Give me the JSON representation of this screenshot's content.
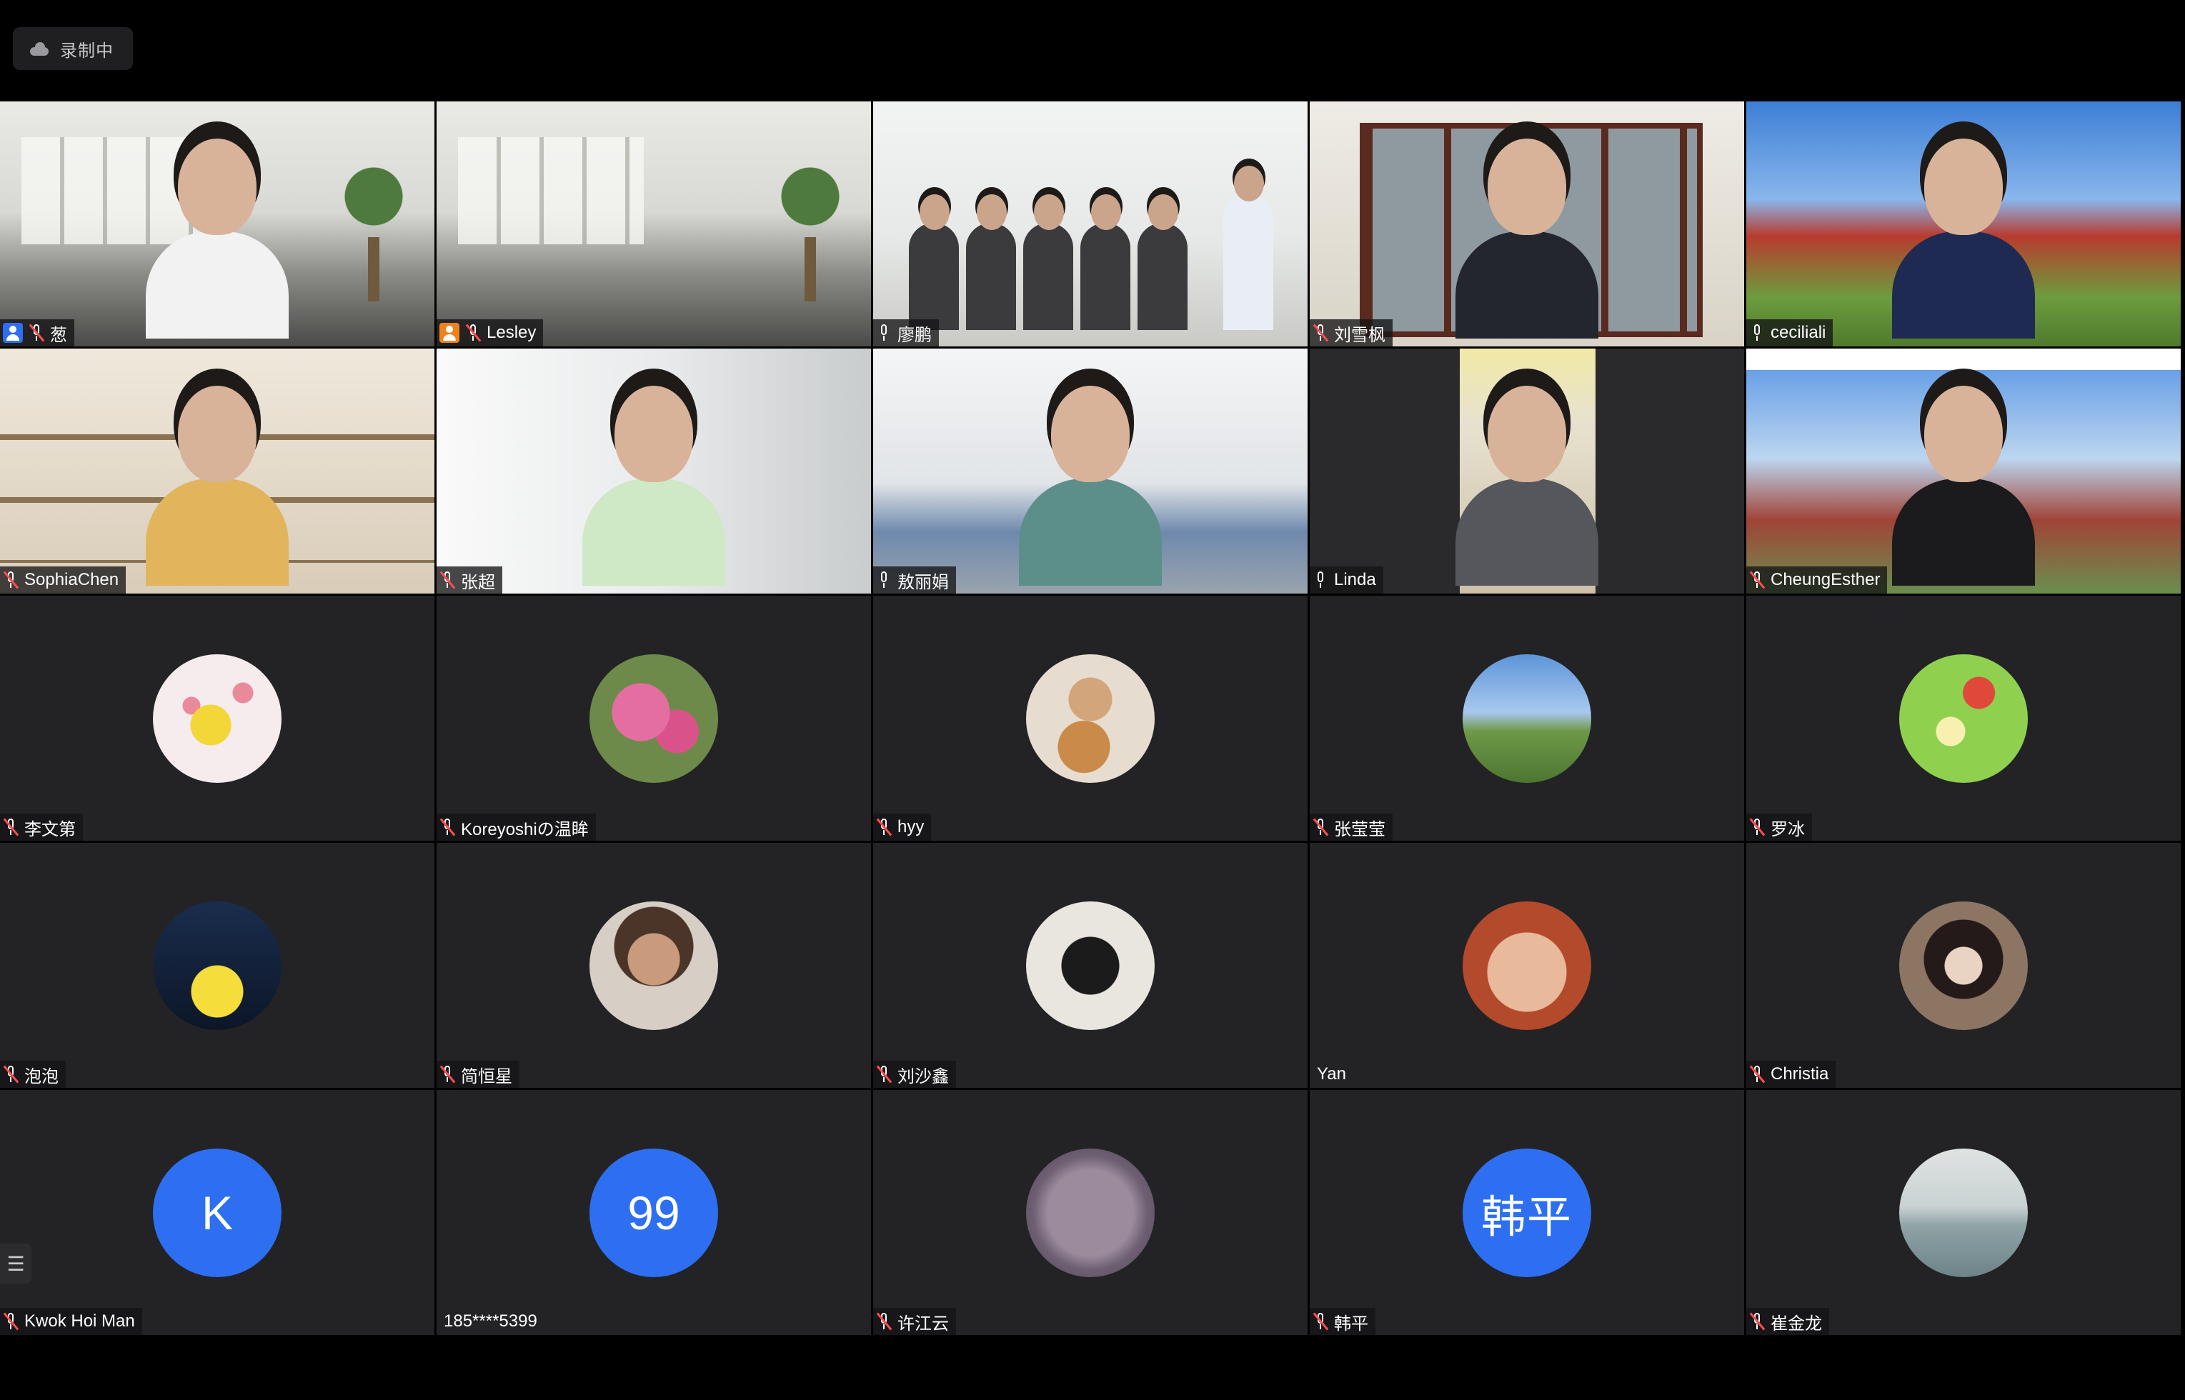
{
  "recording": {
    "label": "录制中"
  },
  "colors": {
    "speaking_border": "#23d160",
    "avatar_letter_bg": "#2d6ff0",
    "tile_bg": "#232326",
    "muted": "#ff4d4f"
  },
  "participants": [
    {
      "name": "葱",
      "kind": "video",
      "scene": "office",
      "host": true,
      "host_color": "#2d6ff0",
      "mic": "muted"
    },
    {
      "name": "Lesley",
      "kind": "video",
      "scene": "office-empty",
      "host": true,
      "host_color": "#f0821e",
      "mic": "muted"
    },
    {
      "name": "廖鹏",
      "kind": "video",
      "scene": "room-group",
      "mic": "on",
      "speaking": true
    },
    {
      "name": "刘雪枫",
      "kind": "video",
      "scene": "library",
      "mic": "muted"
    },
    {
      "name": "ceciliali",
      "kind": "video",
      "scene": "park",
      "mic": "on"
    },
    {
      "name": "SophiaChen",
      "kind": "video",
      "scene": "shelf",
      "mic": "muted"
    },
    {
      "name": "张超",
      "kind": "video",
      "scene": "bright",
      "mic": "muted"
    },
    {
      "name": "敖丽娟",
      "kind": "video",
      "scene": "meeting",
      "mic": "on"
    },
    {
      "name": "Linda",
      "kind": "video",
      "scene": "dark",
      "mic": "on"
    },
    {
      "name": "CheungEsther",
      "kind": "video",
      "scene": "campus",
      "mic": "muted"
    },
    {
      "name": "李文第",
      "kind": "avatar",
      "avatar_icon": "spongebob-hearts-avatar",
      "mic": "muted"
    },
    {
      "name": "Koreyoshiの温眸",
      "kind": "avatar",
      "avatar_icon": "pink-lily-avatar",
      "mic": "muted"
    },
    {
      "name": "hyy",
      "kind": "avatar",
      "avatar_icon": "person-with-dog-avatar",
      "mic": "muted"
    },
    {
      "name": "张莹莹",
      "kind": "avatar",
      "avatar_icon": "mountain-landscape-avatar",
      "mic": "muted"
    },
    {
      "name": "罗冰",
      "kind": "avatar",
      "avatar_icon": "green-cartoon-avatar",
      "mic": "muted"
    },
    {
      "name": "泡泡",
      "kind": "avatar",
      "avatar_icon": "yellow-duck-avatar",
      "mic": "muted"
    },
    {
      "name": "简恒星",
      "kind": "avatar",
      "avatar_icon": "woman-portrait-avatar",
      "mic": "muted"
    },
    {
      "name": "刘沙鑫",
      "kind": "avatar",
      "avatar_icon": "calligraphy-fu-avatar",
      "mic": "muted"
    },
    {
      "name": "Yan",
      "kind": "avatar",
      "avatar_icon": "baby-photo-avatar",
      "mic": "none"
    },
    {
      "name": "Christia",
      "kind": "avatar",
      "avatar_icon": "anime-girl-avatar",
      "mic": "muted"
    },
    {
      "name": "Kwok Hoi Man",
      "kind": "letter",
      "avatar_text": "K",
      "mic": "muted"
    },
    {
      "name": "185****5399",
      "kind": "letter",
      "avatar_text": "99",
      "mic": "none"
    },
    {
      "name": "许江云",
      "kind": "avatar",
      "avatar_icon": "purple-fur-avatar",
      "mic": "muted"
    },
    {
      "name": "韩平",
      "kind": "letter",
      "avatar_text": "韩平",
      "mic": "muted"
    },
    {
      "name": "崔金龙",
      "kind": "avatar",
      "avatar_icon": "lake-landscape-avatar",
      "mic": "muted"
    }
  ],
  "side_handle": {
    "icon": "menu-lines-icon"
  }
}
